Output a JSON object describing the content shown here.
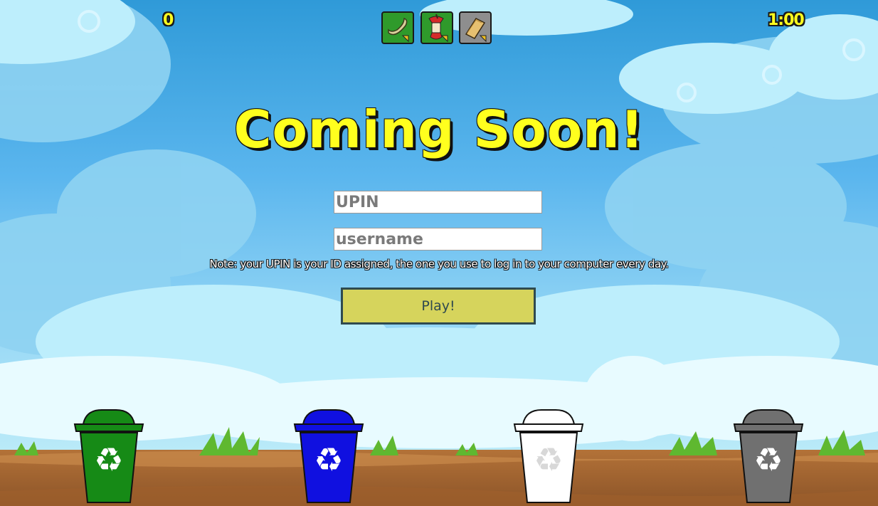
{
  "hud": {
    "score": "0",
    "timer": "1:00",
    "queue": [
      {
        "icon": "banana-peel-icon",
        "bg": "#2f9a2b"
      },
      {
        "icon": "apple-core-icon",
        "bg": "#2f9a2b"
      },
      {
        "icon": "paper-stack-icon",
        "bg": "#8e8e8e"
      }
    ]
  },
  "title": "Coming Soon!",
  "form": {
    "upin_placeholder": "UPIN",
    "username_placeholder": "username",
    "note": "Note: your UPIN is your ID assigned, the one you use to log in to your computer every day.",
    "play_label": "Play!"
  },
  "bins": [
    {
      "name": "green",
      "color": "#168a16"
    },
    {
      "name": "blue",
      "color": "#1010e0"
    },
    {
      "name": "white",
      "color": "#ffffff"
    },
    {
      "name": "gray",
      "color": "#707070"
    }
  ],
  "colors": {
    "title": "#ffff1e",
    "play_button": "#d6d45c",
    "sky": "#4aa8e6",
    "ground": "#b06f3a"
  }
}
